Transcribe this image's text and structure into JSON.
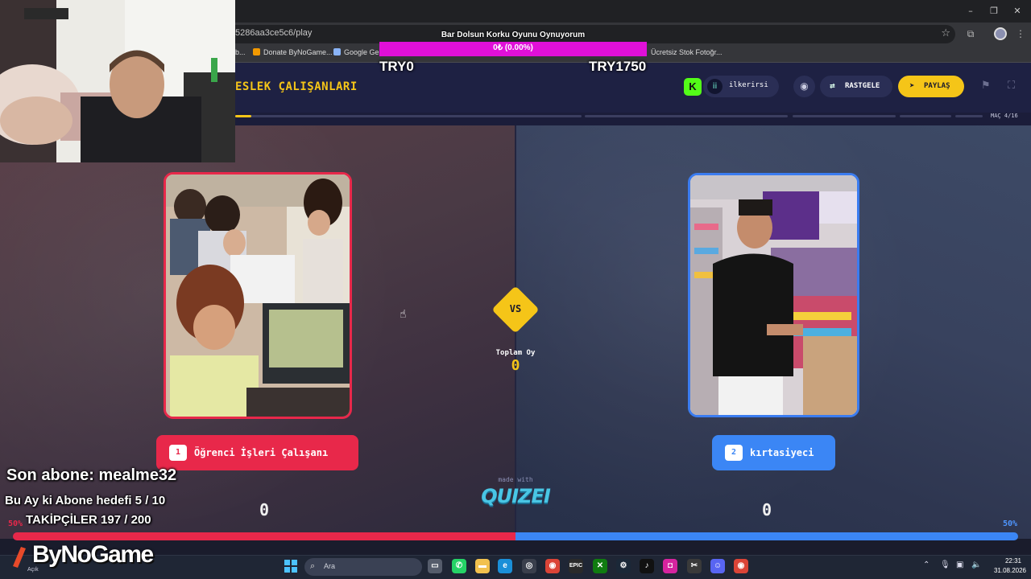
{
  "browser": {
    "url": "5286aa3ce5c6/play",
    "bookmarks": [
      {
        "label": "b...",
        "color": "#9aa0a6"
      },
      {
        "label": "Donate ByNoGame...",
        "color": "#f29900"
      },
      {
        "label": "Google Gem",
        "color": "#8ab4f8"
      },
      {
        "label": "Ücretsiz Stok Fotoğr...",
        "color": "#4285f4"
      }
    ],
    "window_controls": [
      "–",
      "❐",
      "✕"
    ]
  },
  "game": {
    "title": "ESLEK ÇALIŞANLARI",
    "platform_badge": "K",
    "username": "ilkerirsi",
    "random_label": "RASTGELE",
    "share_label": "PAYLAŞ",
    "match_counter": "MAÇ 4/16",
    "vs_label": "VS",
    "total_votes_label": "Toplam Oy",
    "total_votes_value": "0",
    "left_option": {
      "number": "1",
      "label": "Öğrenci İşleri Çalışanı",
      "score": "0",
      "percent": "50%"
    },
    "right_option": {
      "number": "2",
      "label": "kırtasiyeci",
      "score": "0",
      "percent": "50%"
    },
    "made_with": "made with",
    "brand": "QUIZEI",
    "colors": {
      "accent": "#f5c518",
      "left": "#e8284a",
      "right": "#3b86f5",
      "header_bg": "#1e2143"
    }
  },
  "overlay": {
    "donation_title": "Bar Dolsun Korku Oyunu Oynuyorum",
    "donation_value": "0₺ (0.00%)",
    "donation_min": "TRY0",
    "donation_max": "TRY1750",
    "last_subscriber": "Son abone: mealme32",
    "monthly_sub_goal": "Bu Ay ki Abone hedefi 5 / 10",
    "followers": "TAKİPÇİLER 197 / 200",
    "stream_logo": "ByNoGame"
  },
  "taskbar": {
    "search_placeholder": "Ara",
    "left_label": "Açık",
    "time": "22:31",
    "date": "31.08.2026"
  }
}
